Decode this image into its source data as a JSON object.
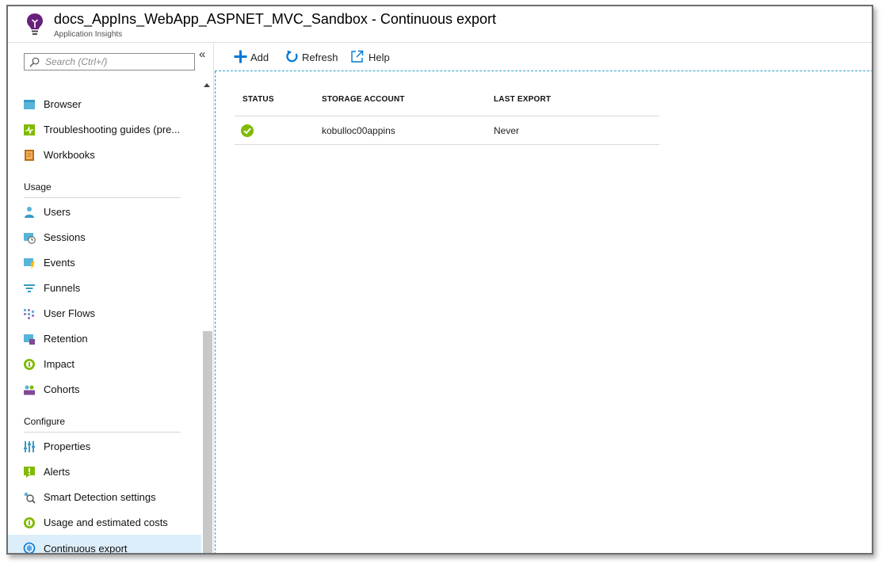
{
  "header": {
    "title": "docs_AppIns_WebApp_ASPNET_MVC_Sandbox - Continuous export",
    "subtitle": "Application Insights"
  },
  "search": {
    "placeholder": "Search (Ctrl+/)"
  },
  "collapse_label": "«",
  "sidebar": {
    "items_top": [
      {
        "label": "Browser",
        "icon": "browser-icon"
      },
      {
        "label": "Troubleshooting guides (pre...",
        "icon": "troubleshooting-icon"
      },
      {
        "label": "Workbooks",
        "icon": "workbooks-icon"
      }
    ],
    "usage_header": "Usage",
    "usage_items": [
      {
        "label": "Users",
        "icon": "users-icon"
      },
      {
        "label": "Sessions",
        "icon": "sessions-icon"
      },
      {
        "label": "Events",
        "icon": "events-icon"
      },
      {
        "label": "Funnels",
        "icon": "funnels-icon"
      },
      {
        "label": "User Flows",
        "icon": "user-flows-icon"
      },
      {
        "label": "Retention",
        "icon": "retention-icon"
      },
      {
        "label": "Impact",
        "icon": "impact-icon"
      },
      {
        "label": "Cohorts",
        "icon": "cohorts-icon"
      }
    ],
    "configure_header": "Configure",
    "configure_items": [
      {
        "label": "Properties",
        "icon": "properties-icon"
      },
      {
        "label": "Alerts",
        "icon": "alerts-icon"
      },
      {
        "label": "Smart Detection settings",
        "icon": "smart-detection-icon"
      },
      {
        "label": "Usage and estimated costs",
        "icon": "usage-costs-icon"
      },
      {
        "label": "Continuous export",
        "icon": "continuous-export-icon",
        "active": true
      }
    ]
  },
  "toolbar": {
    "add_label": "Add",
    "refresh_label": "Refresh",
    "help_label": "Help"
  },
  "table": {
    "columns": [
      "STATUS",
      "STORAGE ACCOUNT",
      "LAST EXPORT"
    ],
    "rows": [
      {
        "status": "ok",
        "storage_account": "kobulloc00appins",
        "last_export": "Never"
      }
    ]
  },
  "colors": {
    "accent_blue": "#0078d4",
    "active_bg": "#ddeefb",
    "status_green": "#7fba00",
    "toolbar_border": "#2fa0c7",
    "logo_purple": "#68217a"
  }
}
